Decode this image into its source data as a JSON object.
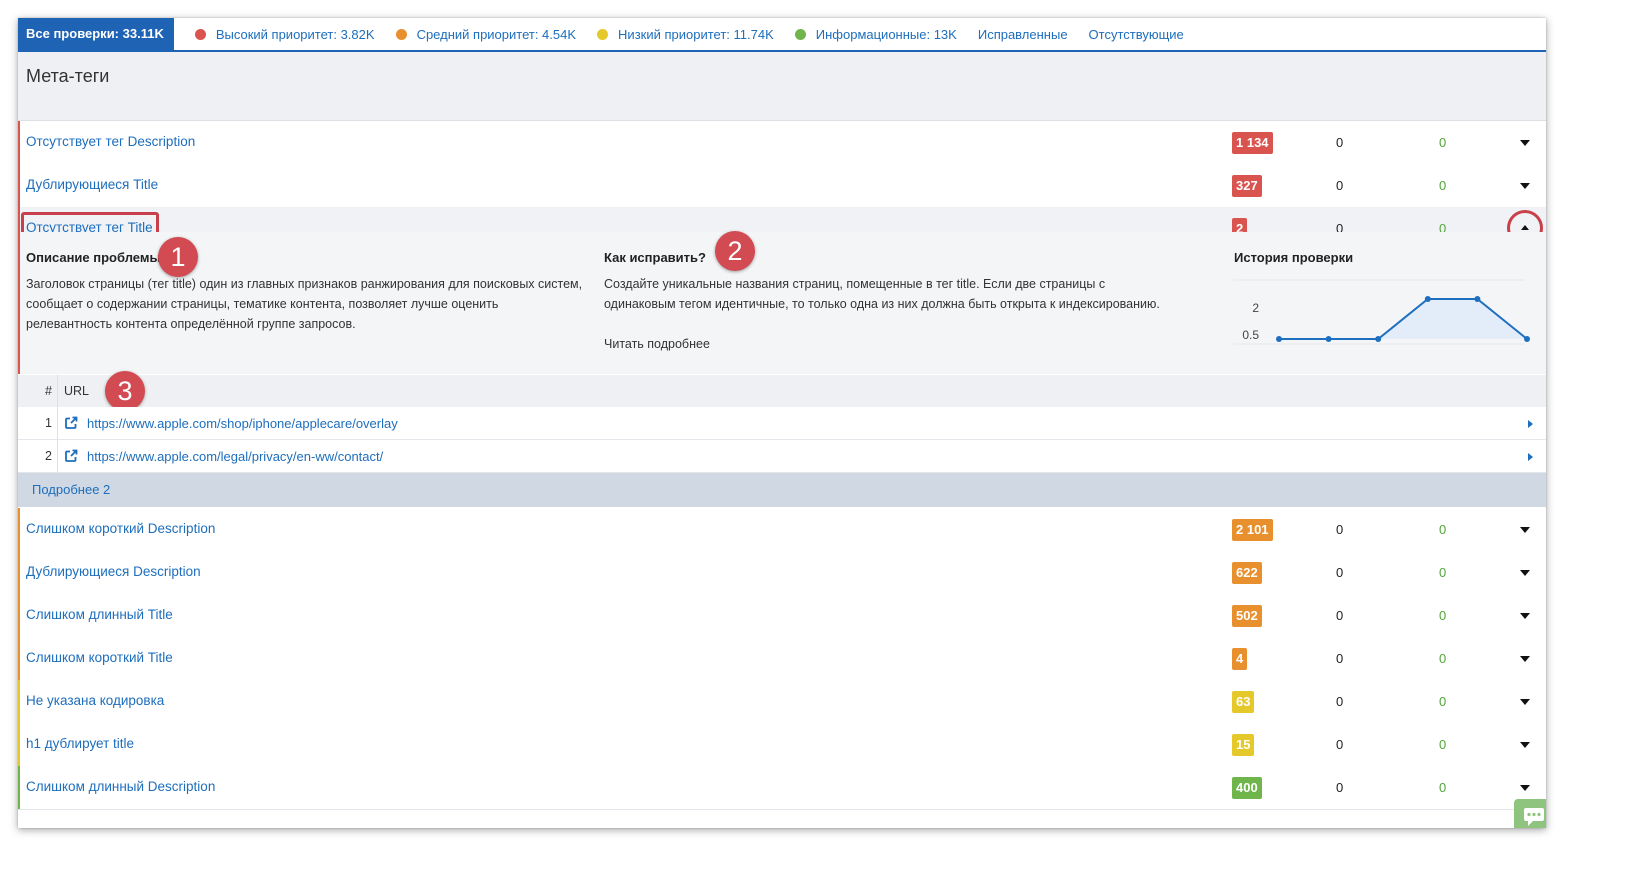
{
  "filters": {
    "all": "Все проверки: 33.11K",
    "items": [
      {
        "label": "Высокий приоритет: 3.82K",
        "color": "#d9534f",
        "icon": "red-dot-icon"
      },
      {
        "label": "Средний приоритет: 4.54K",
        "color": "#e88f2e",
        "icon": "orange-dot-icon"
      },
      {
        "label": "Низкий приоритет: 11.74K",
        "color": "#e5c82a",
        "icon": "yellow-dot-icon"
      },
      {
        "label": "Информационные: 13K",
        "color": "#6fb54c",
        "icon": "green-dot-icon"
      },
      {
        "label": "Исправленные"
      },
      {
        "label": "Отсутствующие"
      }
    ]
  },
  "section_title": "Мета-теги",
  "rows_top": [
    {
      "name": "Отсутствует тег Description",
      "count": "1 134",
      "c1": "0",
      "c2": "0",
      "color": "#d9534f"
    },
    {
      "name": "Дублирующиеся Title",
      "count": "327",
      "c1": "0",
      "c2": "0",
      "color": "#d9534f"
    },
    {
      "name": "Отсутствует тег Title",
      "count": "2",
      "c1": "0",
      "c2": "0",
      "color": "#d9534f"
    }
  ],
  "panel": {
    "problem_title": "Описание проблемы",
    "problem_text": "Заголовок страницы (тег title) один из главных признаков ранжирования для поисковых систем, сообщает о содержании страницы, тематике контента, позволяет лучше оценить релевантность контента определённой группе запросов.",
    "fix_title": "Как исправить?",
    "fix_text": "Создайте уникальные названия страниц, помещенные в тег title. Если две страницы с одинаковым тегом идентичные, то только одна из них должна быть открыта к индексированию.",
    "read_more": "Читать подробнее",
    "history_title": "История проверки",
    "markers": [
      "1",
      "2",
      "3"
    ]
  },
  "chart_data": {
    "type": "area",
    "x": [
      1,
      2,
      3,
      4,
      5,
      6
    ],
    "values": [
      0,
      0,
      0,
      2,
      2,
      0
    ],
    "yticks": [
      "2",
      "0.5"
    ],
    "ylim": [
      0,
      2
    ]
  },
  "urls": {
    "header_idx": "#",
    "header_url": "URL",
    "items": [
      {
        "idx": "1",
        "url": "https://www.apple.com/shop/iphone/applecare/overlay"
      },
      {
        "idx": "2",
        "url": "https://www.apple.com/legal/privacy/en-ww/contact/"
      }
    ],
    "more": "Подробнее 2"
  },
  "rows_bottom": [
    {
      "name": "Слишком короткий Description",
      "count": "2 101",
      "c1": "0",
      "c2": "0",
      "color": "#e88f2e"
    },
    {
      "name": "Дублирующиеся Description",
      "count": "622",
      "c1": "0",
      "c2": "0",
      "color": "#e88f2e"
    },
    {
      "name": "Слишком длинный Title",
      "count": "502",
      "c1": "0",
      "c2": "0",
      "color": "#e88f2e"
    },
    {
      "name": "Слишком короткий Title",
      "count": "4",
      "c1": "0",
      "c2": "0",
      "color": "#e88f2e"
    },
    {
      "name": "Не указана кодировка",
      "count": "63",
      "c1": "0",
      "c2": "0",
      "color": "#e5c82a"
    },
    {
      "name": "h1 дублирует title",
      "count": "15",
      "c1": "0",
      "c2": "0",
      "color": "#e5c82a"
    },
    {
      "name": "Слишком длинный Description",
      "count": "400",
      "c1": "0",
      "c2": "0",
      "color": "#6fb54c"
    }
  ]
}
